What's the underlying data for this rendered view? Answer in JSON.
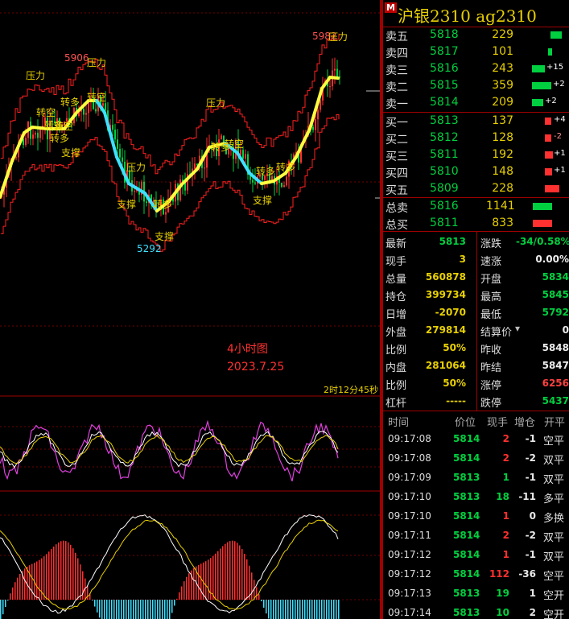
{
  "chart": {
    "annotations": {
      "price_high_left": "5906",
      "price_high_right": "5982",
      "price_low": "5292",
      "pressure": "压力",
      "support": "支撑",
      "turn_short": "转空",
      "turn_long": "转多"
    },
    "center_text": "4小时图",
    "date_text": "2023.7.25",
    "countdown": "2时12分45秒"
  },
  "panel": {
    "badge": "M",
    "title": "沪银2310  ag2310",
    "asks": [
      {
        "label": "卖五",
        "price": "5818",
        "qty": "229",
        "change": ""
      },
      {
        "label": "卖四",
        "price": "5817",
        "qty": "101",
        "change": ""
      },
      {
        "label": "卖三",
        "price": "5816",
        "qty": "243",
        "change": "+15"
      },
      {
        "label": "卖二",
        "price": "5815",
        "qty": "359",
        "change": "+2"
      },
      {
        "label": "卖一",
        "price": "5814",
        "qty": "209",
        "change": "+2"
      }
    ],
    "bids": [
      {
        "label": "买一",
        "price": "5813",
        "qty": "137",
        "change": "+4"
      },
      {
        "label": "买二",
        "price": "5812",
        "qty": "128",
        "change": "-2"
      },
      {
        "label": "买三",
        "price": "5811",
        "qty": "192",
        "change": "+1"
      },
      {
        "label": "买四",
        "price": "5810",
        "qty": "148",
        "change": "+1"
      },
      {
        "label": "买五",
        "price": "5809",
        "qty": "228",
        "change": ""
      }
    ],
    "totals": [
      {
        "label": "总卖",
        "price": "5816",
        "qty": "1141"
      },
      {
        "label": "总买",
        "price": "5811",
        "qty": "833"
      }
    ],
    "stats": [
      {
        "l1": "最新",
        "v1": "5813",
        "c1": "#00d040",
        "l2": "涨跌",
        "v2": "-34/0.58%",
        "c2": "#00d040"
      },
      {
        "l1": "现手",
        "v1": "3",
        "c1": "#e8d000",
        "l2": "速涨",
        "v2": "0.00%",
        "c2": "#eeeeee"
      },
      {
        "l1": "总量",
        "v1": "560878",
        "c1": "#e8d000",
        "l2": "开盘",
        "v2": "5834",
        "c2": "#00d040"
      },
      {
        "l1": "持仓",
        "v1": "399734",
        "c1": "#e8d000",
        "l2": "最高",
        "v2": "5845",
        "c2": "#00d040"
      },
      {
        "l1": "日增",
        "v1": "-2070",
        "c1": "#e8d000",
        "l2": "最低",
        "v2": "5792",
        "c2": "#00d040"
      },
      {
        "l1": "外盘",
        "v1": "279814",
        "c1": "#e8d000",
        "l2": "结算价",
        "v2": "0",
        "c2": "#eeeeee"
      },
      {
        "l1": "比例",
        "v1": "50%",
        "c1": "#e8d000",
        "l2": "昨收",
        "v2": "5848",
        "c2": "#eeeeee"
      },
      {
        "l1": "内盘",
        "v1": "281064",
        "c1": "#e8d000",
        "l2": "昨结",
        "v2": "5847",
        "c2": "#eeeeee"
      },
      {
        "l1": "比例",
        "v1": "50%",
        "c1": "#e8d000",
        "l2": "涨停",
        "v2": "6256",
        "c2": "#ff4040"
      },
      {
        "l1": "杠杆",
        "v1": "-----",
        "c1": "#e8d000",
        "l2": "跌停",
        "v2": "5437",
        "c2": "#00d040"
      }
    ],
    "ticks_header": {
      "time": "时间",
      "price": "价位",
      "vol": "现手",
      "oi": "增仓",
      "kind": "开平"
    },
    "ticks": [
      {
        "time": "09:17:08",
        "price": "5814",
        "vol": "2",
        "oi": "-1",
        "kind": "空平",
        "pc": "#00d040",
        "vc": "#ff3030"
      },
      {
        "time": "09:17:08",
        "price": "5814",
        "vol": "2",
        "oi": "-2",
        "kind": "双平",
        "pc": "#00d040",
        "vc": "#ff3030"
      },
      {
        "time": "09:17:09",
        "price": "5813",
        "vol": "1",
        "oi": "-1",
        "kind": "双平",
        "pc": "#00d040",
        "vc": "#00d040"
      },
      {
        "time": "09:17:10",
        "price": "5813",
        "vol": "18",
        "oi": "-11",
        "kind": "多平",
        "pc": "#00d040",
        "vc": "#00d040"
      },
      {
        "time": "09:17:10",
        "price": "5814",
        "vol": "1",
        "oi": "0",
        "kind": "多换",
        "pc": "#00d040",
        "vc": "#ff3030"
      },
      {
        "time": "09:17:11",
        "price": "5814",
        "vol": "2",
        "oi": "-2",
        "kind": "双平",
        "pc": "#00d040",
        "vc": "#ff3030"
      },
      {
        "time": "09:17:12",
        "price": "5814",
        "vol": "1",
        "oi": "-1",
        "kind": "双平",
        "pc": "#00d040",
        "vc": "#ff3030"
      },
      {
        "time": "09:17:12",
        "price": "5814",
        "vol": "112",
        "oi": "-36",
        "kind": "空平",
        "pc": "#00d040",
        "vc": "#ff3030"
      },
      {
        "time": "09:17:13",
        "price": "5813",
        "vol": "19",
        "oi": "1",
        "kind": "空开",
        "pc": "#00d040",
        "vc": "#00d040"
      },
      {
        "time": "09:17:14",
        "price": "5813",
        "vol": "10",
        "oi": "2",
        "kind": "空开",
        "pc": "#00d040",
        "vc": "#00d040"
      }
    ]
  },
  "colors": {
    "up": "#ff3030",
    "down": "#00d040",
    "ma_up": "#ffff40",
    "ma_down": "#40e0ff",
    "band": "#ff2020",
    "separator": "#a00000",
    "label_yellow": "#e8d000"
  },
  "icons": {
    "settle_dropdown": "triangle-down-icon"
  }
}
